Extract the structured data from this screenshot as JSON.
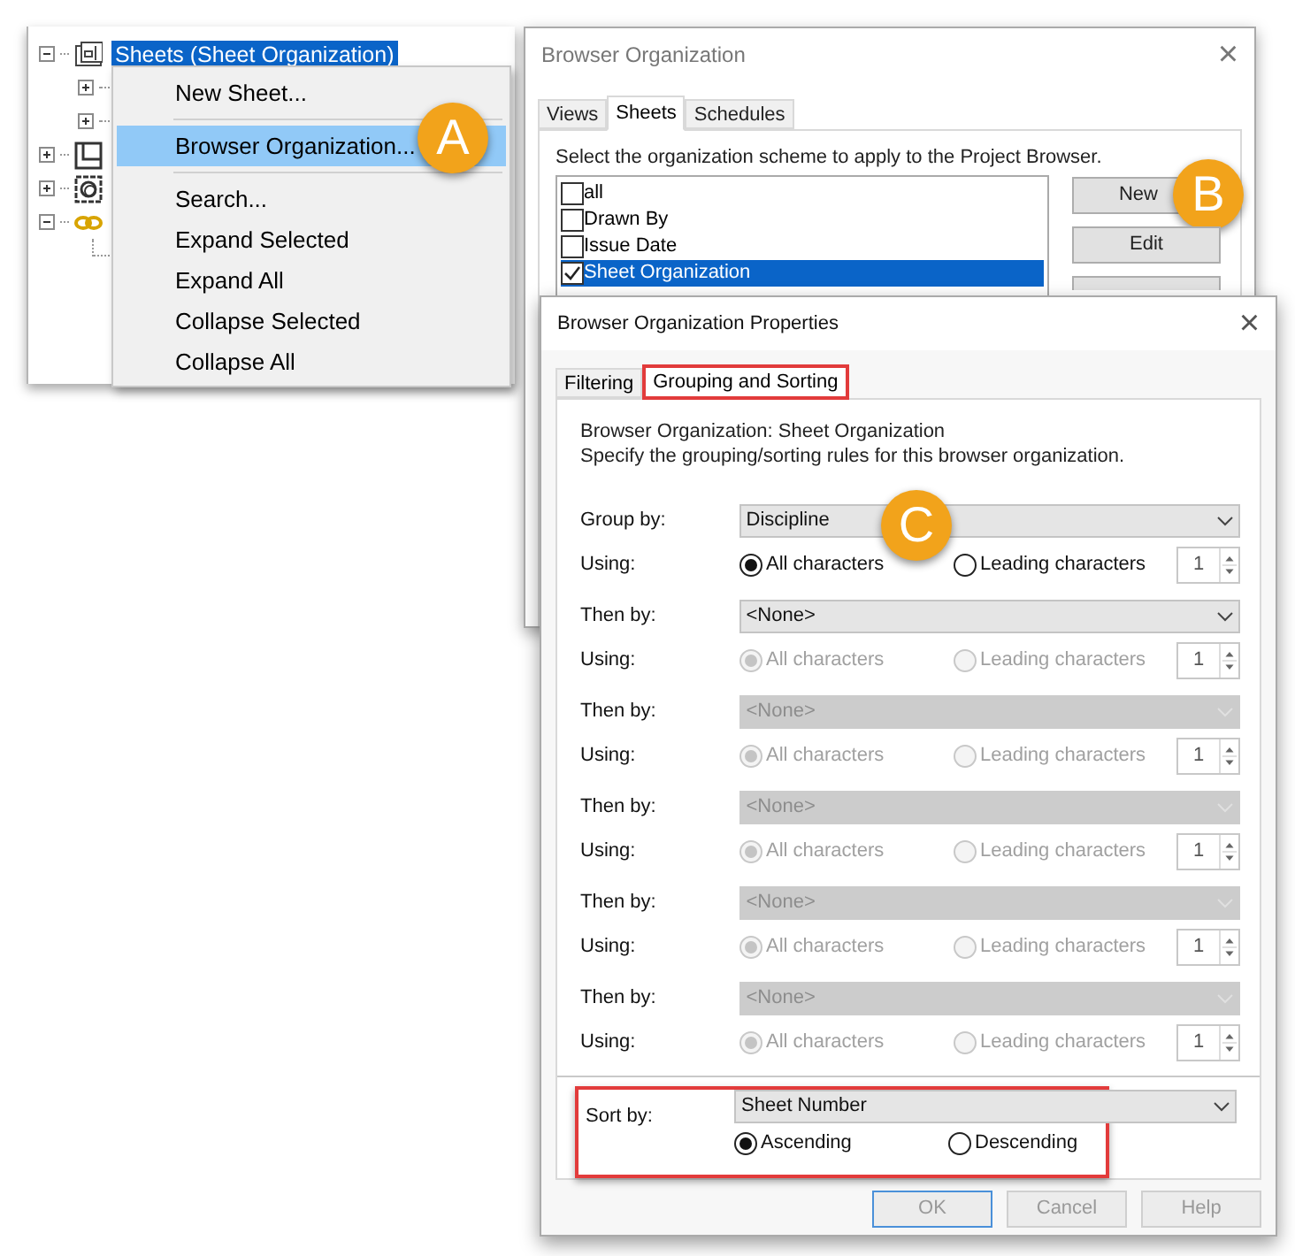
{
  "project_browser": {
    "nodes": [
      {
        "kind": "sheet-set",
        "label": "Sheets (Sheet Organization)",
        "expanded": true,
        "selected": true,
        "children": [
          {
            "kind": "branch",
            "expanded": false
          },
          {
            "kind": "branch",
            "expanded": false
          }
        ]
      },
      {
        "kind": "square-set",
        "expanded": false
      },
      {
        "kind": "round-set",
        "expanded": false
      },
      {
        "kind": "chain-set",
        "expanded": true,
        "children": [
          {
            "kind": "leaf"
          }
        ]
      }
    ]
  },
  "context_menu": {
    "items": [
      {
        "kind": "item",
        "label": "New Sheet...",
        "selected": false
      },
      {
        "kind": "separator"
      },
      {
        "kind": "item",
        "label": "Browser Organization...",
        "selected": true,
        "callout": "A"
      },
      {
        "kind": "separator"
      },
      {
        "kind": "item",
        "label": "Search...",
        "selected": false
      },
      {
        "kind": "item",
        "label": "Expand Selected",
        "selected": false
      },
      {
        "kind": "item",
        "label": "Expand All",
        "selected": false
      },
      {
        "kind": "item",
        "label": "Collapse Selected",
        "selected": false
      },
      {
        "kind": "item",
        "label": "Collapse All",
        "selected": false
      }
    ]
  },
  "browser_organization": {
    "title": "Browser Organization",
    "close": "×",
    "tabs": [
      {
        "label": "Views",
        "selected": false
      },
      {
        "label": "Sheets",
        "selected": true
      },
      {
        "label": "Schedules",
        "selected": false
      }
    ],
    "instruction": "Select the organization scheme to apply to the Project Browser.",
    "schemes": [
      {
        "label": "all",
        "checked": false,
        "selected": false
      },
      {
        "label": "Drawn By",
        "checked": false,
        "selected": false
      },
      {
        "label": "Issue Date",
        "checked": false,
        "selected": false
      },
      {
        "label": "Sheet Organization",
        "checked": true,
        "selected": true
      }
    ],
    "buttons": [
      {
        "label": "New",
        "callout": "B"
      },
      {
        "label": "Edit"
      }
    ]
  },
  "properties": {
    "title": "Browser Organization Properties",
    "close": "×",
    "tabs": [
      {
        "label": "Filtering",
        "selected": false,
        "outlined": false
      },
      {
        "label": "Grouping and Sorting",
        "selected": true,
        "outlined": true
      }
    ],
    "heading": "Browser Organization: Sheet Organization",
    "description": "Specify the grouping/sorting rules for this browser organization.",
    "rules": [
      {
        "label": "Group by:",
        "value": "Discipline",
        "disabled": false,
        "callout": "C",
        "using_label": "Using:",
        "using_disabled": false,
        "options": [
          {
            "label": "All characters",
            "selected": true
          },
          {
            "label": "Leading characters",
            "selected": false
          }
        ],
        "count": "1"
      },
      {
        "label": "Then by:",
        "value": "<None>",
        "disabled": false,
        "using_label": "Using:",
        "using_disabled": true,
        "options": [
          {
            "label": "All characters",
            "selected": true
          },
          {
            "label": "Leading characters",
            "selected": false
          }
        ],
        "count": "1"
      },
      {
        "label": "Then by:",
        "value": "<None>",
        "disabled": true,
        "using_label": "Using:",
        "using_disabled": true,
        "options": [
          {
            "label": "All characters",
            "selected": true
          },
          {
            "label": "Leading characters",
            "selected": false
          }
        ],
        "count": "1"
      },
      {
        "label": "Then by:",
        "value": "<None>",
        "disabled": true,
        "using_label": "Using:",
        "using_disabled": true,
        "options": [
          {
            "label": "All characters",
            "selected": true
          },
          {
            "label": "Leading characters",
            "selected": false
          }
        ],
        "count": "1"
      },
      {
        "label": "Then by:",
        "value": "<None>",
        "disabled": true,
        "using_label": "Using:",
        "using_disabled": true,
        "options": [
          {
            "label": "All characters",
            "selected": true
          },
          {
            "label": "Leading characters",
            "selected": false
          }
        ],
        "count": "1"
      },
      {
        "label": "Then by:",
        "value": "<None>",
        "disabled": true,
        "using_label": "Using:",
        "using_disabled": true,
        "options": [
          {
            "label": "All characters",
            "selected": true
          },
          {
            "label": "Leading characters",
            "selected": false
          }
        ],
        "count": "1"
      }
    ],
    "sort": {
      "label": "Sort by:",
      "value": "Sheet Number",
      "outlined": true,
      "options": [
        {
          "label": "Ascending",
          "selected": true
        },
        {
          "label": "Descending",
          "selected": false
        }
      ]
    },
    "buttons": [
      {
        "label": "OK",
        "default": true
      },
      {
        "label": "Cancel",
        "default": false
      },
      {
        "label": "Help",
        "default": false
      }
    ]
  }
}
